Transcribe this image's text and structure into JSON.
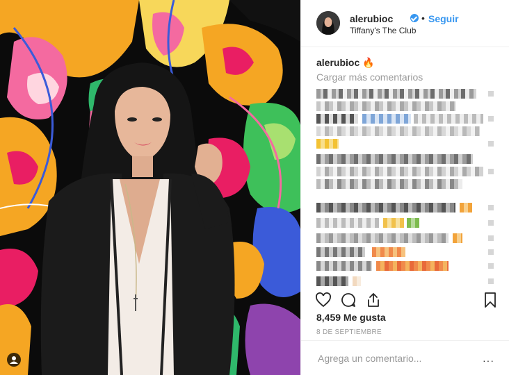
{
  "post": {
    "username": "alerubioc",
    "follow_label": "Seguir",
    "separator": "•",
    "location": "Tiffany's The Club",
    "caption_text": "🔥",
    "load_more_label": "Cargar más comentarios",
    "likes": "8,459 Me gusta",
    "date": "8 DE SEPTIEMBRE",
    "add_comment_placeholder": "Agrega un comentario...",
    "options_label": "···"
  },
  "icons": {
    "heart": "heart-icon",
    "comment": "comment-icon",
    "share": "share-icon",
    "bookmark": "bookmark-icon",
    "verified": "verified-badge-icon",
    "tag": "user-tag-icon"
  },
  "colors": {
    "link_blue": "#3897f0",
    "muted": "#999999",
    "text": "#262626"
  }
}
